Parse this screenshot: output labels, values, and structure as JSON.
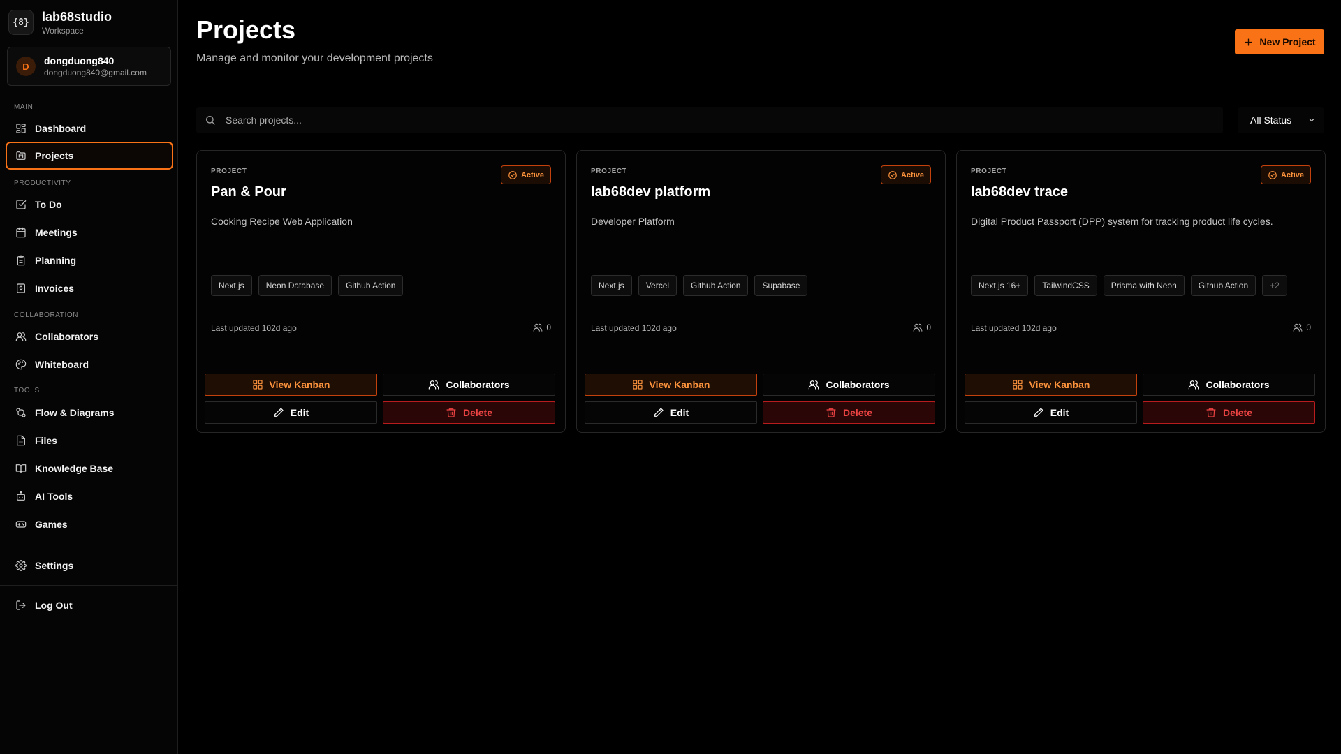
{
  "brand": {
    "logo_text": "{8}",
    "name": "lab68studio",
    "subtitle": "Workspace"
  },
  "user": {
    "initial": "D",
    "name": "dongduong840",
    "email": "dongduong840@gmail.com"
  },
  "nav": {
    "main_label": "MAIN",
    "dashboard": "Dashboard",
    "projects": "Projects",
    "productivity_label": "PRODUCTIVITY",
    "todo": "To Do",
    "meetings": "Meetings",
    "planning": "Planning",
    "invoices": "Invoices",
    "collaboration_label": "COLLABORATION",
    "collaborators": "Collaborators",
    "whiteboard": "Whiteboard",
    "tools_label": "TOOLS",
    "flow": "Flow & Diagrams",
    "files": "Files",
    "knowledge": "Knowledge Base",
    "ai_tools": "AI Tools",
    "games": "Games",
    "settings": "Settings",
    "logout": "Log Out"
  },
  "header": {
    "title": "Projects",
    "subtitle": "Manage and monitor your development projects",
    "new_button": "New Project"
  },
  "filters": {
    "search_placeholder": "Search projects...",
    "status_value": "All Status"
  },
  "colors": {
    "accent": "#f97316",
    "danger": "#ef4444",
    "background": "#000000"
  },
  "projects": [
    {
      "label": "PROJECT",
      "status": "Active",
      "name": "Pan & Pour",
      "description": "Cooking Recipe Web Application",
      "tags": [
        "Next.js",
        "Neon Database",
        "Github Action"
      ],
      "updated": "Last updated 102d ago",
      "collaborators": "0",
      "actions": {
        "kanban": "View Kanban",
        "collaborators": "Collaborators",
        "edit": "Edit",
        "delete": "Delete"
      }
    },
    {
      "label": "PROJECT",
      "status": "Active",
      "name": "lab68dev platform",
      "description": "Developer Platform",
      "tags": [
        "Next.js",
        "Vercel",
        "Github Action",
        "Supabase"
      ],
      "updated": "Last updated 102d ago",
      "collaborators": "0",
      "actions": {
        "kanban": "View Kanban",
        "collaborators": "Collaborators",
        "edit": "Edit",
        "delete": "Delete"
      }
    },
    {
      "label": "PROJECT",
      "status": "Active",
      "name": "lab68dev trace",
      "description": "Digital Product Passport (DPP) system for tracking product life cycles.",
      "tags": [
        "Next.js 16+",
        "TailwindCSS",
        "Prisma with Neon",
        "Github Action",
        "+2"
      ],
      "updated": "Last updated 102d ago",
      "collaborators": "0",
      "actions": {
        "kanban": "View Kanban",
        "collaborators": "Collaborators",
        "edit": "Edit",
        "delete": "Delete"
      }
    }
  ]
}
